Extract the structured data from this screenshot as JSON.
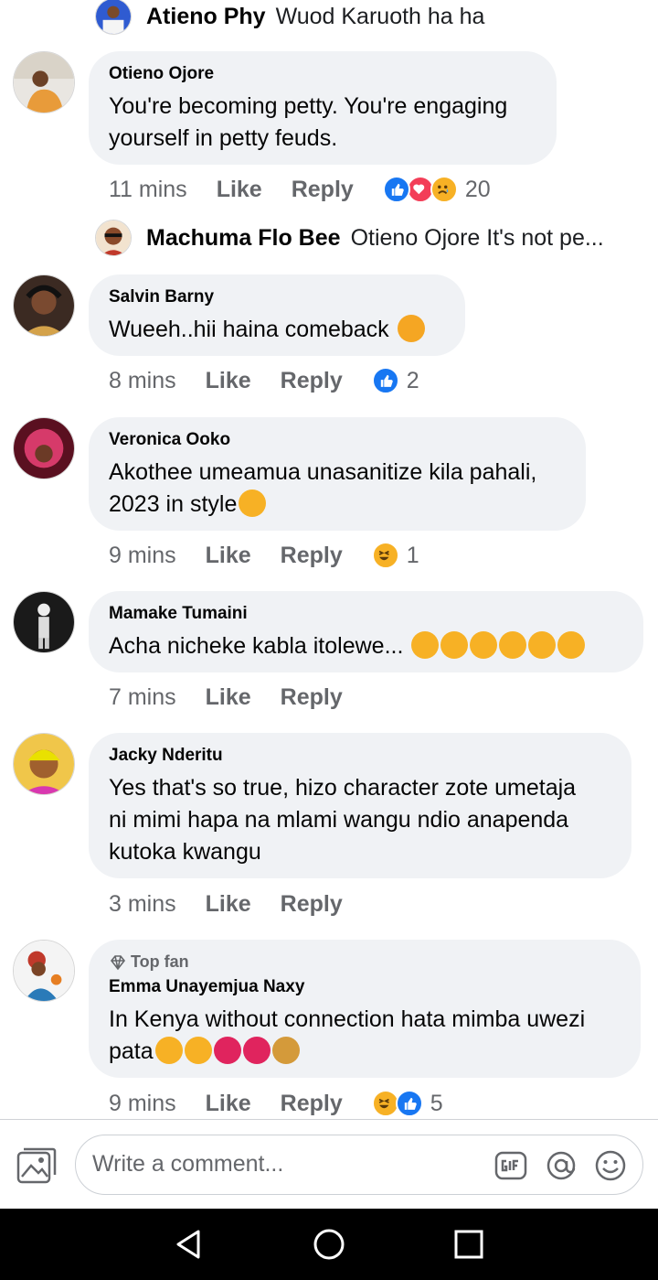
{
  "top_reply": {
    "name": "Atieno Phy",
    "text": "Wuod Karuoth ha ha"
  },
  "comments": [
    {
      "author": "Otieno Ojore",
      "text_lines": [
        "You're becoming petty. You're engaging",
        "yourself in petty feuds."
      ],
      "time": "11 mins",
      "like": "Like",
      "reply": "Reply",
      "reaction_count": "20"
    },
    {
      "author": "Salvin Barny",
      "text": "Wueeh..hii haina comeback",
      "time": "8 mins",
      "like": "Like",
      "reply": "Reply",
      "reaction_count": "2"
    },
    {
      "author": "Veronica Ooko",
      "text_lines": [
        "Akothee umeamua unasanitize kila pahali,",
        "2023 in style"
      ],
      "time": "9 mins",
      "like": "Like",
      "reply": "Reply",
      "reaction_count": "1"
    },
    {
      "author": "Mamake Tumaini",
      "text": "Acha nicheke kabla itolewe...",
      "time": "7 mins",
      "like": "Like",
      "reply": "Reply"
    },
    {
      "author": "Jacky Nderitu",
      "text_lines": [
        "Yes that's so true, hizo character zote umetaja",
        "ni mimi hapa na mlami wangu ndio anapenda",
        "kutoka kwangu"
      ],
      "time": "3 mins",
      "like": "Like",
      "reply": "Reply"
    },
    {
      "badge": "Top fan",
      "author": "Emma Unayemjua Naxy",
      "text_lines": [
        "In Kenya without connection hata mimba uwezi",
        "pata"
      ],
      "time": "9 mins",
      "like": "Like",
      "reply": "Reply",
      "reaction_count": "5"
    }
  ],
  "nested_reply": {
    "name": "Machuma Flo Bee",
    "text": "Otieno Ojore It's not pe..."
  },
  "composer": {
    "placeholder": "Write a comment..."
  },
  "colors": {
    "bubble": "#f0f2f5",
    "like_blue": "#1877f2",
    "love_red": "#f33e58",
    "emoji_yellow": "#f7b125",
    "meta_gray": "#65676b"
  }
}
